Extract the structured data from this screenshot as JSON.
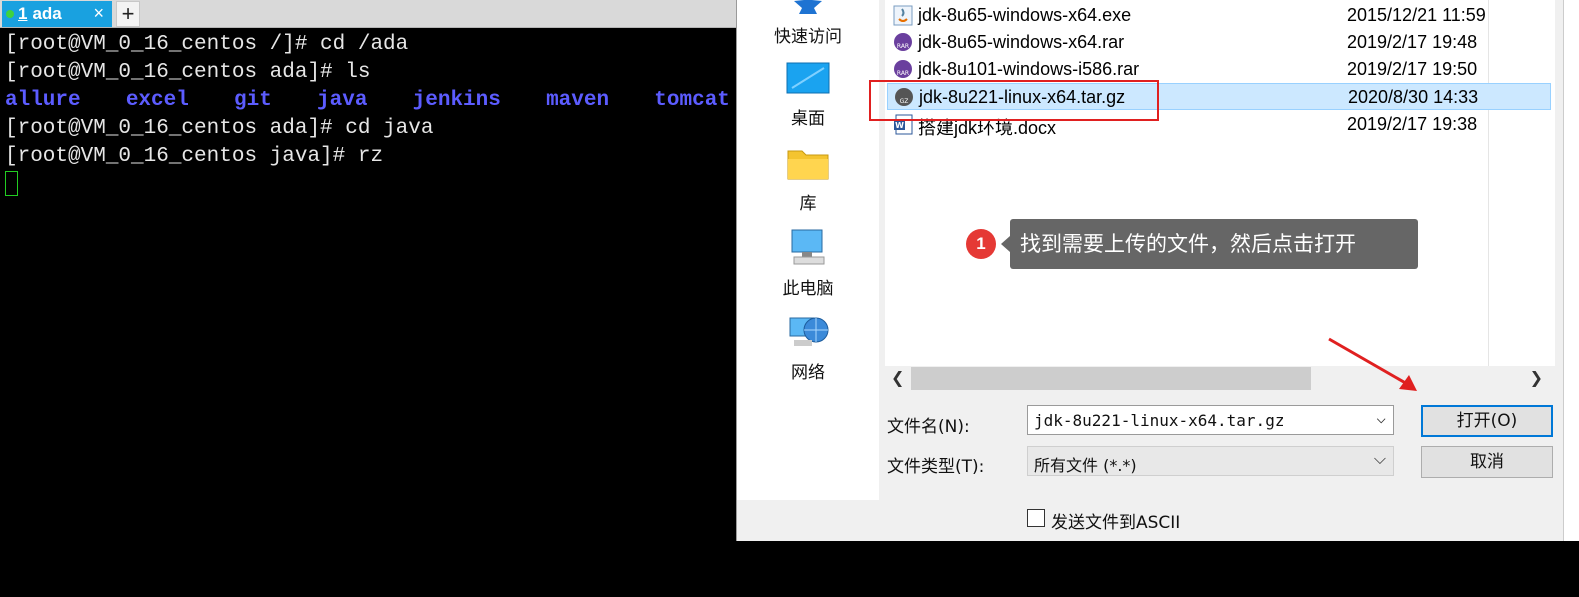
{
  "terminal": {
    "tab_number": "1",
    "tab_name": "ada",
    "tab_close": "×",
    "tab_add": "+",
    "lines": [
      "[root@VM_0_16_centos /]# cd /ada",
      "[root@VM_0_16_centos ada]# ls",
      "allure  excel  git  java  jenkins  maven  tomcat",
      "[root@VM_0_16_centos ada]# cd java",
      "[root@VM_0_16_centos java]# rz"
    ]
  },
  "dialog": {
    "places": [
      {
        "label": "快速访问",
        "icon": "star-icon"
      },
      {
        "label": "桌面",
        "icon": "desktop-icon"
      },
      {
        "label": "库",
        "icon": "library-folder-icon"
      },
      {
        "label": "此电脑",
        "icon": "computer-icon"
      },
      {
        "label": "网络",
        "icon": "network-icon"
      }
    ],
    "files": [
      {
        "name": "jdk-8u65-windows-x64.exe",
        "date": "2015/12/21 11:59",
        "icon": "java-exe-icon"
      },
      {
        "name": "jdk-8u65-windows-x64.rar",
        "date": "2019/2/17 19:48",
        "icon": "rar-icon"
      },
      {
        "name": "jdk-8u101-windows-i586.rar",
        "date": "2019/2/17 19:50",
        "icon": "rar-icon"
      },
      {
        "name": "jdk-8u221-linux-x64.tar.gz",
        "date": "2020/8/30 14:33",
        "icon": "gz-icon"
      },
      {
        "name": "搭建jdk环境.docx",
        "date": "2019/2/17 19:38",
        "icon": "word-icon"
      }
    ],
    "filename_label": "文件名(N):",
    "filename_value": "jdk-8u221-linux-x64.tar.gz",
    "filetype_label": "文件类型(T):",
    "filetype_value": "所有文件 (*.*)",
    "open_button": "打开(O)",
    "cancel_button": "取消",
    "ascii_checkbox_label": "发送文件到ASCII",
    "ascii_checked": false
  },
  "annotation": {
    "step_number": "1",
    "tooltip_text": "找到需要上传的文件，然后点击打开"
  },
  "colors": {
    "tab_active": "#19a1e0",
    "ls_output": "#5c5cff",
    "selection": "#cce8ff",
    "highlight_border": "#e02020",
    "badge": "#e53935",
    "tooltip_bg": "#666666"
  }
}
